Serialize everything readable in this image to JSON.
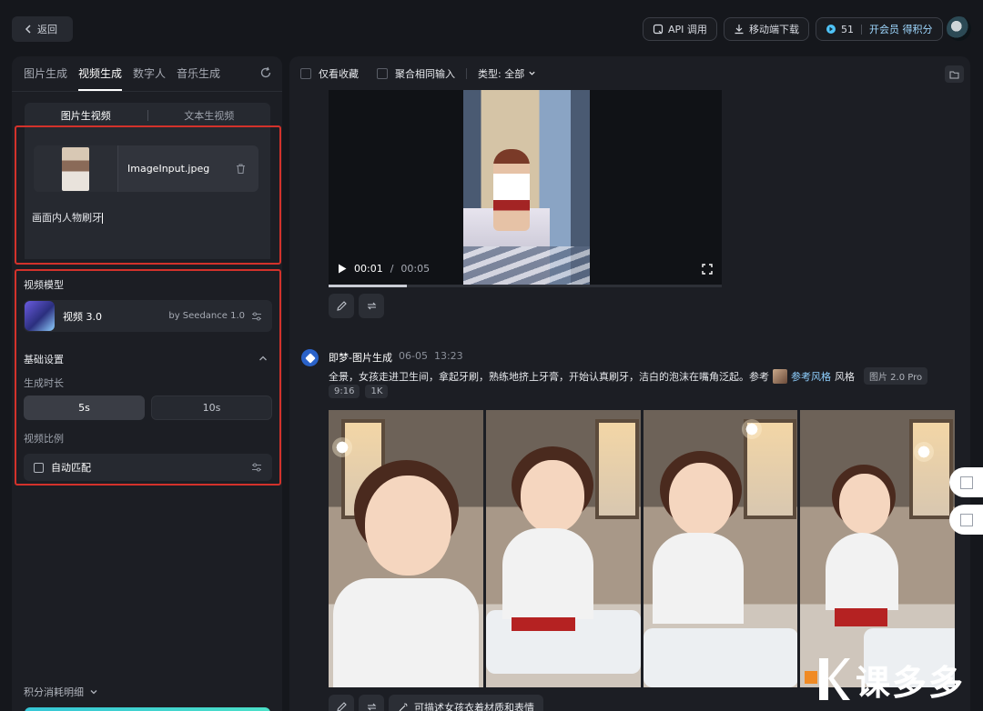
{
  "header": {
    "back_label": "返回",
    "api_label": "API 调用",
    "download_label": "移动端下载",
    "points": "51",
    "member_label": "开会员 得积分"
  },
  "left": {
    "tabs": [
      {
        "label": "图片生成",
        "active": false
      },
      {
        "label": "视频生成",
        "active": true
      },
      {
        "label": "数字人",
        "active": false
      },
      {
        "label": "音乐生成",
        "active": false
      }
    ],
    "mode_tabs": [
      {
        "label": "图片生视频",
        "active": true
      },
      {
        "label": "文本生视频",
        "active": false
      }
    ],
    "file_name": "ImageInput.jpeg",
    "prompt": "画面内人物刷牙",
    "model_section": "视频模型",
    "model_name": "视频 3.0",
    "model_by": "by Seedance 1.0",
    "basic_settings": "基础设置",
    "duration_label": "生成时长",
    "durations": [
      {
        "label": "5s",
        "selected": true
      },
      {
        "label": "10s",
        "selected": false
      }
    ],
    "ratio_label": "视频比例",
    "ratio_value": "自动匹配",
    "credits_label": "积分消耗明细"
  },
  "right": {
    "filter_favorites": "仅看收藏",
    "filter_merge": "聚合相同输入",
    "type_filter": "类型: 全部",
    "video": {
      "current_time": "00:01",
      "separator": "/",
      "total_time": "00:05",
      "progress": 0.2
    },
    "generation": {
      "source": "即梦-图片生成",
      "date": "06-05",
      "time": "13:23",
      "prompt": "全景，女孩走进卫生间，拿起牙刷，熟练地挤上牙膏，开始认真刷牙，洁白的泡沫在嘴角泛起。参考",
      "ref_label": "参考风格",
      "style_suffix": "风格",
      "model_tag": "图片 2.0 Pro",
      "ratio_tag": "9:16",
      "res_tag": "1K"
    },
    "describe_label": "可描述女孩衣着材质和表情"
  },
  "watermark": {
    "text": "课多多"
  },
  "colors": {
    "highlight_border": "#d3322b",
    "accent_blue": "#2a62c9",
    "link": "#8fd0ff"
  }
}
